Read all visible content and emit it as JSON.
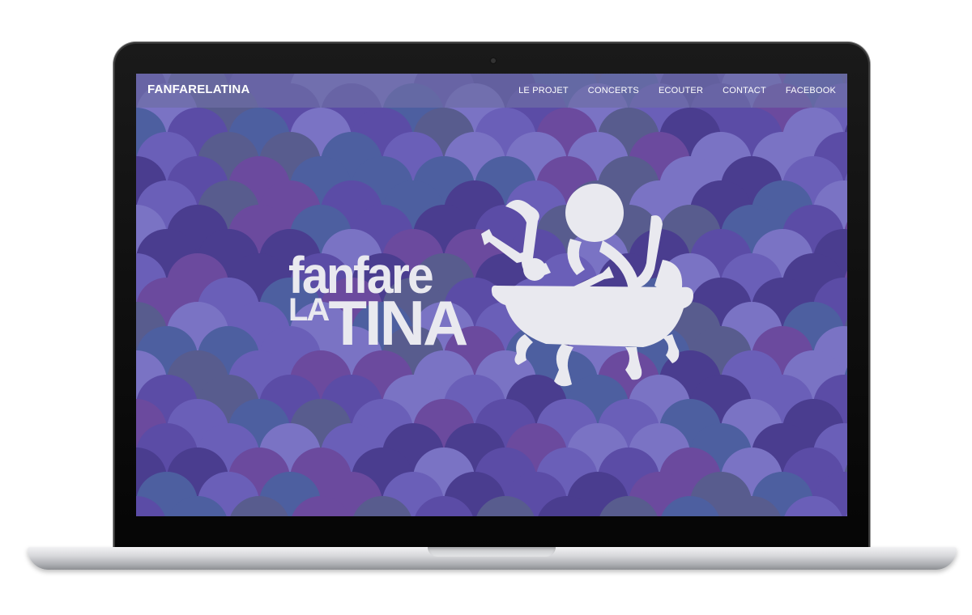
{
  "site": {
    "brand": "FANFARELATINA",
    "nav": [
      {
        "label": "LE PROJET"
      },
      {
        "label": "CONCERTS"
      },
      {
        "label": "ECOUTER"
      },
      {
        "label": "CONTACT"
      },
      {
        "label": "FACEBOOK"
      }
    ]
  },
  "hero": {
    "logo_line1": "fanfare",
    "logo_la": "LA",
    "logo_tina": "TINA",
    "logo_art_icon": "bathtub-instruments-icon"
  },
  "colors": {
    "scale_palette": [
      "#4a3d8f",
      "#5b4ca6",
      "#6a5fb8",
      "#7a73c4",
      "#585c8e",
      "#6b4a9e",
      "#4d5fa0"
    ],
    "logo_fill": "#e9e9ef"
  }
}
